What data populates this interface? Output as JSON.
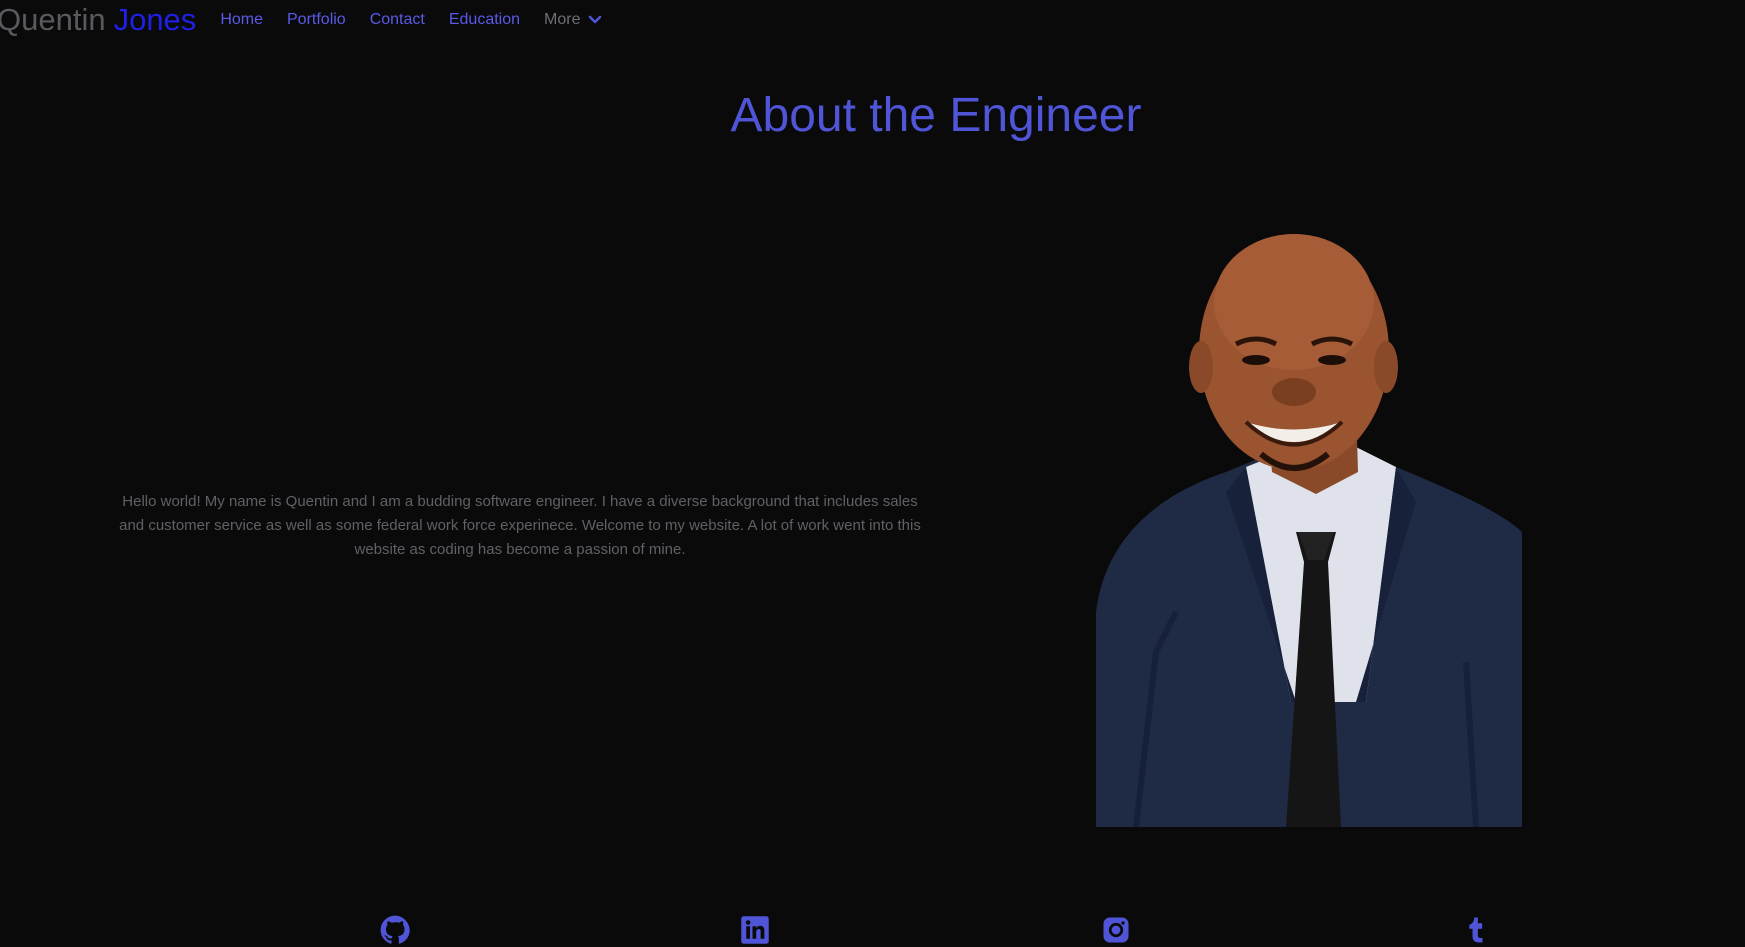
{
  "nav": {
    "brand_first": "Quentin",
    "brand_last": "Jones",
    "links": [
      "Home",
      "Portfolio",
      "Contact",
      "Education"
    ],
    "more_label": "More"
  },
  "main": {
    "title": "About the Engineer",
    "bio": "Hello world! My name is Quentin and I am a budding software engineer. I have a diverse background that includes sales and customer service as well as some federal work force experinece. Welcome to my website. A lot of work went into this website as coding has become a passion of mine."
  },
  "social": {
    "icons": [
      "github-icon",
      "linkedin-icon",
      "instagram-icon",
      "tumblr-icon"
    ]
  },
  "colors": {
    "background": "#0a0a0b",
    "accent": "#4f55d6",
    "brand_blue": "#1f1fe6",
    "muted_text": "#606066"
  }
}
